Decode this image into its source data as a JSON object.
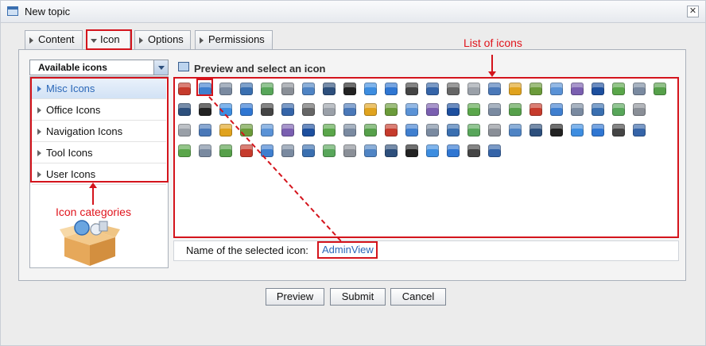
{
  "window": {
    "title": "New topic",
    "close_label": "✕"
  },
  "tabs": [
    {
      "label": "Content",
      "active": false
    },
    {
      "label": "Icon",
      "active": true
    },
    {
      "label": "Options",
      "active": false
    },
    {
      "label": "Permissions",
      "active": false
    }
  ],
  "category_dropdown": {
    "value": "Available icons"
  },
  "categories": [
    {
      "label": "Misc Icons",
      "selected": true
    },
    {
      "label": "Office Icons",
      "selected": false
    },
    {
      "label": "Navigation Icons",
      "selected": false
    },
    {
      "label": "Tool Icons",
      "selected": false
    },
    {
      "label": "User Icons",
      "selected": false
    }
  ],
  "preview": {
    "title": "Preview and select an icon",
    "name_label": "Name of the selected icon:",
    "selected_icon_name": "AdminView"
  },
  "icon_grid": {
    "rows": [
      [
        "pdf",
        "admin-view",
        "tools",
        "window",
        "window-bar",
        "keyboard",
        "list",
        "window-split",
        "terminal",
        "globe",
        "info",
        "bomb",
        "book",
        "link",
        "cube",
        "list-numbered",
        "folder-arrow",
        "checklist",
        "chat-bubble",
        "pen-window",
        "network",
        "css",
        "printer",
        "download"
      ],
      [
        "refresh",
        "edit-star",
        "puzzle",
        "fire-truck",
        "book-open",
        "flash",
        "doc-red",
        "pen-box",
        "font",
        "hand",
        "home",
        "html",
        "hammer",
        "calendar",
        "folder-doc",
        "folder-tree",
        "folder-yellow",
        "box-arrow",
        "window-stack",
        "info-blue",
        "window-gray",
        "window-list",
        "chain"
      ],
      [
        "lock",
        "card",
        "pencil",
        "medal",
        "new",
        "paper",
        "document",
        "reader",
        "mail",
        "money",
        "contact",
        "rainbow",
        "recycle",
        "rss",
        "rss-feed",
        "search-doc",
        "shield",
        "pointer",
        "speaker",
        "medal-star",
        "star-badge",
        "bar-chart",
        "eye"
      ],
      [
        "tag",
        "page",
        "text",
        "linux",
        "scissors",
        "cd",
        "window-blank",
        "cloud",
        "sun-cloud",
        "storm",
        "rain",
        "snow",
        "sun",
        "globe-blue",
        "html-blue",
        "star"
      ]
    ],
    "colors": [
      "#c63b2c",
      "#3f7fcf",
      "#7a8aa0",
      "#3a6fb0",
      "#58a65a",
      "#8a8f97",
      "#4f84c4",
      "#2d4f7c",
      "#222222",
      "#3d8de0",
      "#2f76d2",
      "#444444",
      "#3564a8",
      "#666666",
      "#9aa0a8",
      "#4a78b8",
      "#e0a31e",
      "#6b9b3a",
      "#5a92d6",
      "#7a5fb0",
      "#1d4f9e",
      "#5aa64a",
      "#7a8aa0",
      "#56a04a"
    ]
  },
  "annotations": {
    "list_of_icons": "List of icons",
    "icon_categories": "Icon categories"
  },
  "buttons": {
    "preview": "Preview",
    "submit": "Submit",
    "cancel": "Cancel"
  }
}
